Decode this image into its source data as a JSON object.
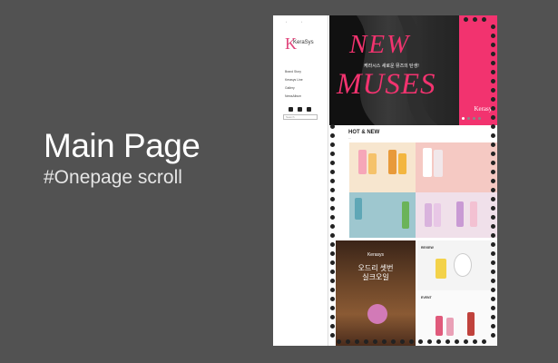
{
  "slide": {
    "title": "Main Page",
    "subtitle": "#Onepage scroll"
  },
  "sidebar": {
    "brand": "KeraSys",
    "menu": [
      "Brand Story",
      "Kerasys Line",
      "Gallery",
      "NewsAlbum"
    ],
    "search_placeholder": "Search"
  },
  "hero": {
    "headline_line1": "NEW",
    "headline_line2": "MUSES",
    "korean_text": "케라시스 새로운 뮤즈의 탄생!",
    "brand": "Kerasys",
    "slide_count": 4,
    "active_slide": 1
  },
  "hot_new": {
    "label": "HOT & NEW"
  },
  "bottom": {
    "hair_title": "Kerasys",
    "hair_korean_1": "오드리 셋번",
    "hair_korean_2": "실크오일",
    "review_label": "REVIEW",
    "event_label": "EVENT"
  },
  "colors": {
    "accent_pink": "#f2336f",
    "background": "#525252"
  }
}
